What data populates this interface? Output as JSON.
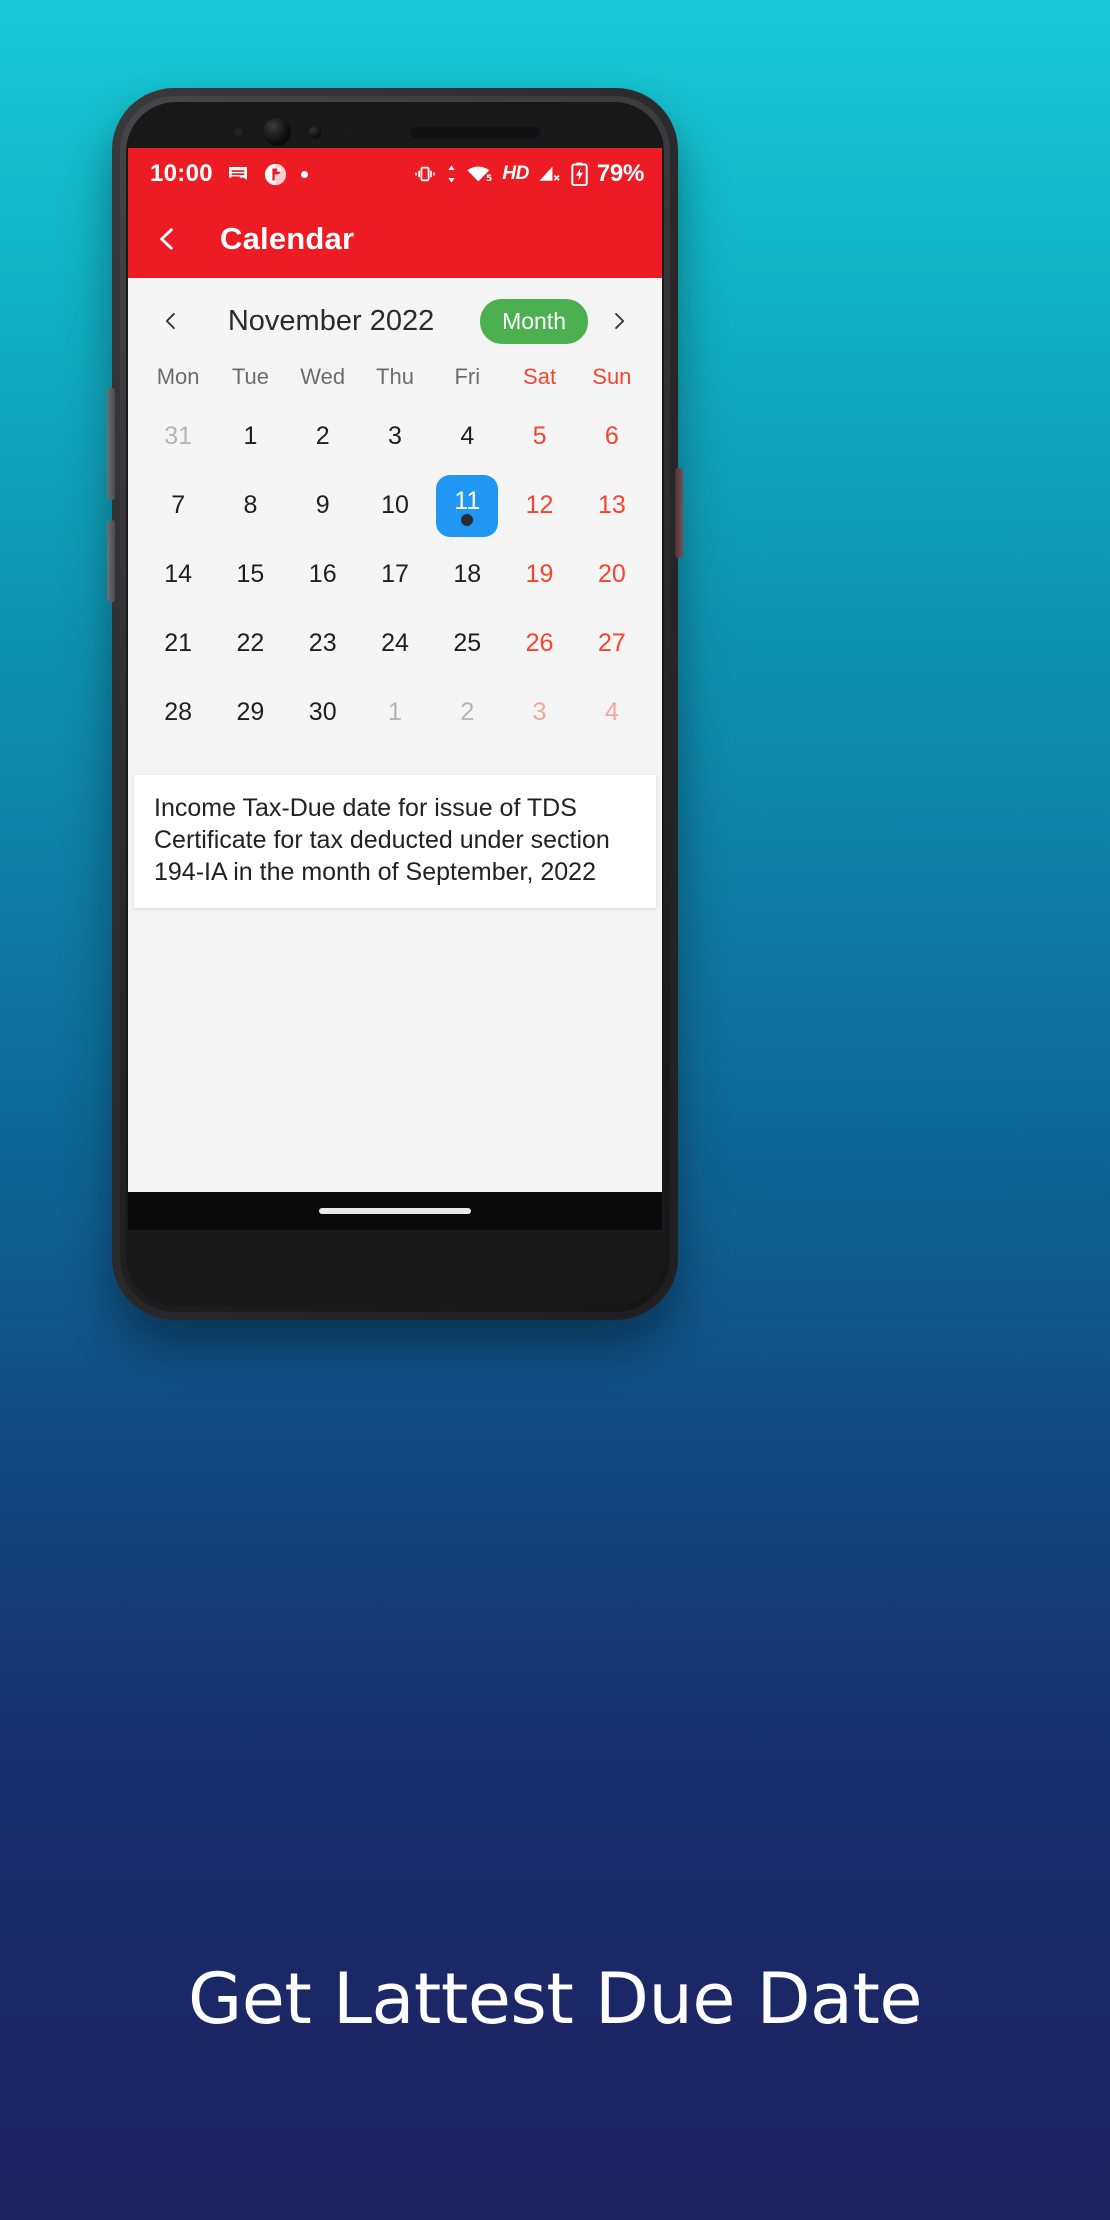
{
  "background": {
    "gradient_top": "#16C9D6",
    "gradient_bottom": "#1E2160"
  },
  "status_bar": {
    "time": "10:00",
    "background_color": "#ED1C24",
    "left_icons": [
      "message-icon",
      "app-badge-icon",
      "dot-icon"
    ],
    "right_icons": [
      "vibrate-icon",
      "data-transfer-icon",
      "wifi-5-icon",
      "hd-icon",
      "signal-no-service-icon",
      "battery-icon"
    ],
    "hd_label": "HD",
    "wifi_label": "5",
    "battery_percent": "79%"
  },
  "app_bar": {
    "back_icon": "chevron-left-icon",
    "title": "Calendar",
    "background_color": "#ED1C24"
  },
  "calendar": {
    "prev_icon": "chevron-left-icon",
    "next_icon": "chevron-right-icon",
    "month_label": "November 2022",
    "view_mode_label": "Month",
    "view_mode_color": "#4CAF50",
    "weekdays": [
      {
        "label": "Mon",
        "weekend": false
      },
      {
        "label": "Tue",
        "weekend": false
      },
      {
        "label": "Wed",
        "weekend": false
      },
      {
        "label": "Thu",
        "weekend": false
      },
      {
        "label": "Fri",
        "weekend": false
      },
      {
        "label": "Sat",
        "weekend": true
      },
      {
        "label": "Sun",
        "weekend": true
      }
    ],
    "selected_day": 11,
    "selected_color": "#2196F3",
    "event_dot_color": "#2B2B33",
    "weeks": [
      [
        {
          "n": "31",
          "other": true,
          "weekend": false
        },
        {
          "n": "1",
          "other": false,
          "weekend": false
        },
        {
          "n": "2",
          "other": false,
          "weekend": false
        },
        {
          "n": "3",
          "other": false,
          "weekend": false
        },
        {
          "n": "4",
          "other": false,
          "weekend": false
        },
        {
          "n": "5",
          "other": false,
          "weekend": true
        },
        {
          "n": "6",
          "other": false,
          "weekend": true
        }
      ],
      [
        {
          "n": "7",
          "other": false,
          "weekend": false
        },
        {
          "n": "8",
          "other": false,
          "weekend": false
        },
        {
          "n": "9",
          "other": false,
          "weekend": false
        },
        {
          "n": "10",
          "other": false,
          "weekend": false
        },
        {
          "n": "11",
          "other": false,
          "weekend": false,
          "selected": true,
          "has_event": true
        },
        {
          "n": "12",
          "other": false,
          "weekend": true
        },
        {
          "n": "13",
          "other": false,
          "weekend": true
        }
      ],
      [
        {
          "n": "14",
          "other": false,
          "weekend": false
        },
        {
          "n": "15",
          "other": false,
          "weekend": false
        },
        {
          "n": "16",
          "other": false,
          "weekend": false
        },
        {
          "n": "17",
          "other": false,
          "weekend": false
        },
        {
          "n": "18",
          "other": false,
          "weekend": false
        },
        {
          "n": "19",
          "other": false,
          "weekend": true
        },
        {
          "n": "20",
          "other": false,
          "weekend": true
        }
      ],
      [
        {
          "n": "21",
          "other": false,
          "weekend": false
        },
        {
          "n": "22",
          "other": false,
          "weekend": false
        },
        {
          "n": "23",
          "other": false,
          "weekend": false
        },
        {
          "n": "24",
          "other": false,
          "weekend": false
        },
        {
          "n": "25",
          "other": false,
          "weekend": false
        },
        {
          "n": "26",
          "other": false,
          "weekend": true
        },
        {
          "n": "27",
          "other": false,
          "weekend": true
        }
      ],
      [
        {
          "n": "28",
          "other": false,
          "weekend": false
        },
        {
          "n": "29",
          "other": false,
          "weekend": false
        },
        {
          "n": "30",
          "other": false,
          "weekend": false
        },
        {
          "n": "1",
          "other": true,
          "weekend": false
        },
        {
          "n": "2",
          "other": true,
          "weekend": false
        },
        {
          "n": "3",
          "other": true,
          "weekend": true
        },
        {
          "n": "4",
          "other": true,
          "weekend": true
        }
      ]
    ]
  },
  "event": {
    "text": "Income Tax-Due date for issue of TDS Certificate for tax deducted under section 194-IA in the month of September, 2022"
  },
  "caption": {
    "text": "Get Lattest Due Date"
  }
}
